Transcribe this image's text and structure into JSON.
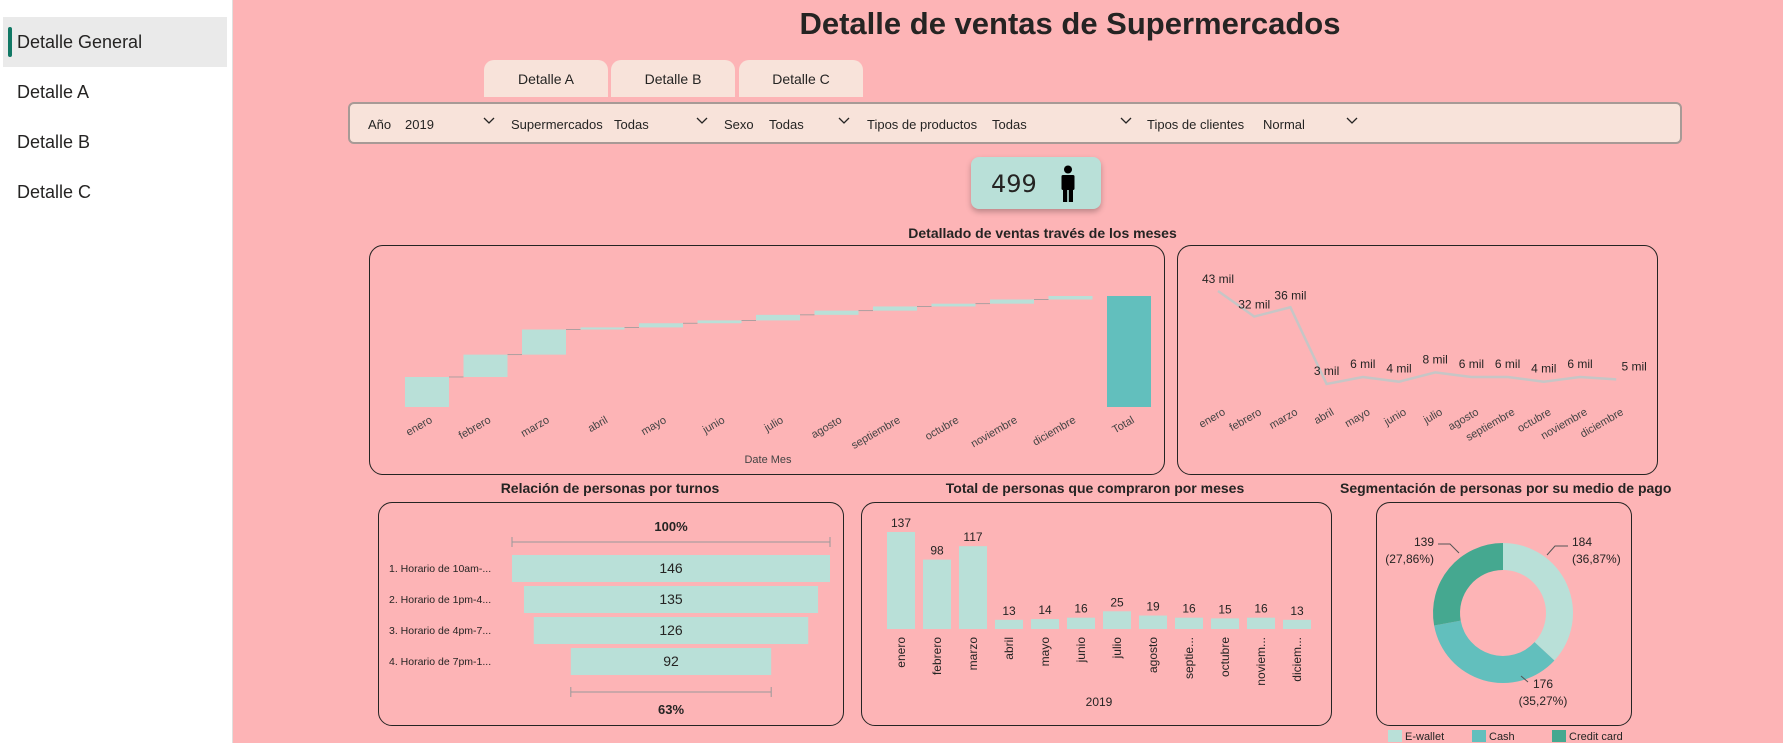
{
  "sidebar": {
    "items": [
      {
        "label": "Detalle General",
        "active": true
      },
      {
        "label": "Detalle A"
      },
      {
        "label": "Detalle B"
      },
      {
        "label": "Detalle C"
      }
    ]
  },
  "header": {
    "title": "Detalle de ventas de Supermercados"
  },
  "tabs": [
    "Detalle A",
    "Detalle B",
    "Detalle C"
  ],
  "filters": {
    "anio_label": "Año",
    "anio_value": "2019",
    "super_label": "Supermercados",
    "super_value": "Todas",
    "sexo_label": "Sexo",
    "sexo_value": "Todas",
    "productos_label": "Tipos de productos",
    "productos_value": "Todas",
    "clientes_label": "Tipos de clientes",
    "clientes_value": "Normal"
  },
  "kpi": {
    "value": "499",
    "icon": "person-icon"
  },
  "colors": {
    "background": "#fdb4b6",
    "teal_light": "#b9e0d8",
    "teal_mid": "#62bfbd",
    "teal_dark": "#45a890",
    "panel_bg": "#f8e3da"
  },
  "sections": {
    "months_title": "Detallado de ventas través de los meses",
    "turnos_title": "Relación de personas por turnos",
    "personas_title": "Total de personas que compraron por meses",
    "pago_title": "Segmentación de personas por su medio de pago"
  },
  "chart_data": [
    {
      "type": "waterfall",
      "categories": [
        "enero",
        "febrero",
        "marzo",
        "abril",
        "mayo",
        "junio",
        "julio",
        "agosto",
        "septiembre",
        "octubre",
        "noviembre",
        "diciembre",
        "Total"
      ],
      "values": [
        43,
        32,
        36,
        3,
        6,
        4,
        8,
        6,
        6,
        4,
        6,
        5,
        159
      ],
      "xlabel": "Date Mes"
    },
    {
      "type": "line",
      "categories": [
        "enero",
        "febrero",
        "marzo",
        "abril",
        "mayo",
        "junio",
        "julio",
        "agosto",
        "septiembre",
        "octubre",
        "noviembre",
        "diciembre"
      ],
      "values": [
        43,
        32,
        36,
        3,
        6,
        4,
        8,
        6,
        6,
        4,
        6,
        5
      ],
      "labels": [
        "43 mil",
        "32 mil",
        "36 mil",
        "3 mil",
        "6 mil",
        "4 mil",
        "8 mil",
        "6 mil",
        "6 mil",
        "4 mil",
        "6 mil",
        "5 mil"
      ]
    },
    {
      "type": "funnel",
      "categories": [
        "1. Horario de 10am-...",
        "2. Horario de 1pm-4...",
        "3. Horario de 4pm-7...",
        "4. Horario de 7pm-1..."
      ],
      "values": [
        146,
        135,
        126,
        92
      ],
      "top_label": "100%",
      "bottom_label": "63%"
    },
    {
      "type": "bar",
      "categories": [
        "enero",
        "febrero",
        "marzo",
        "abril",
        "mayo",
        "junio",
        "julio",
        "agosto",
        "septie...",
        "octubre",
        "noviem...",
        "diciem..."
      ],
      "values": [
        137,
        98,
        117,
        13,
        14,
        16,
        25,
        19,
        16,
        15,
        16,
        13
      ],
      "xlabel": "2019"
    },
    {
      "type": "pie",
      "categories": [
        "E-wallet",
        "Cash",
        "Credit card"
      ],
      "values": [
        184,
        176,
        139
      ],
      "labels": [
        "184",
        "176",
        "139"
      ],
      "percents": [
        "(36,87%)",
        "(35,27%)",
        "(27,86%)"
      ],
      "colors": [
        "#b9e0d8",
        "#62bfbd",
        "#45a890"
      ]
    }
  ]
}
